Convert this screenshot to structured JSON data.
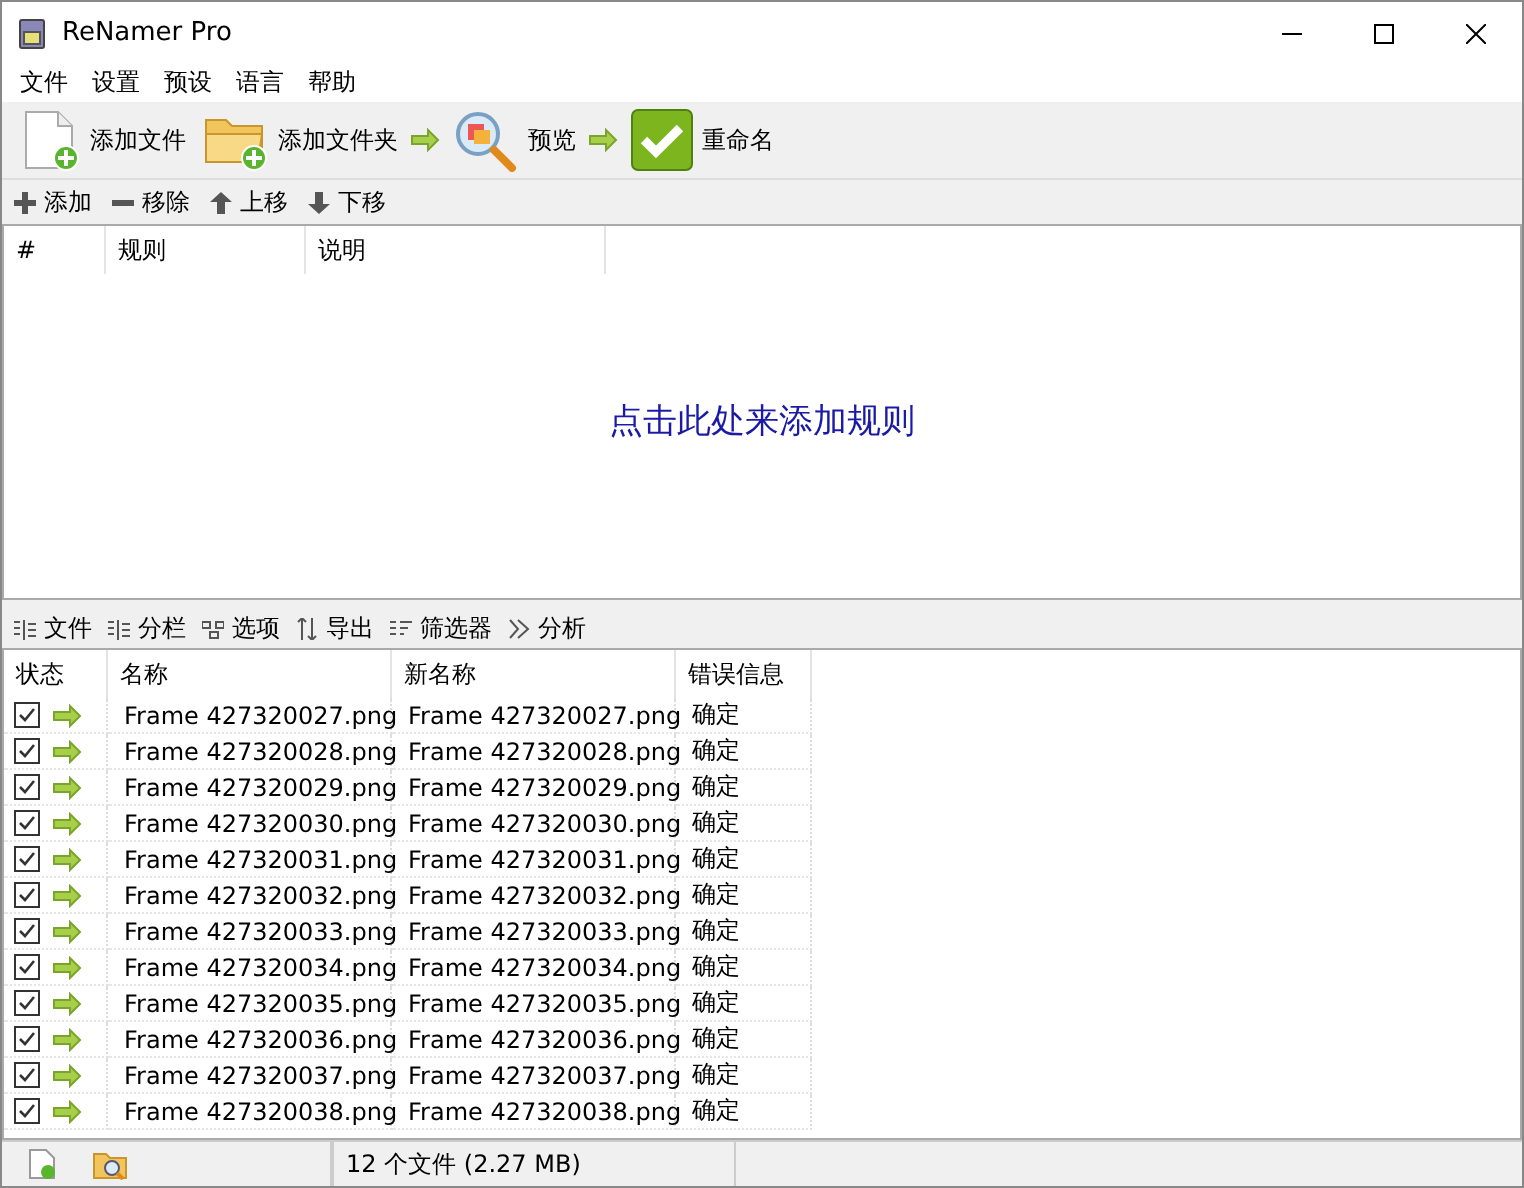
{
  "window": {
    "title": "ReNamer Pro"
  },
  "menu": [
    "文件",
    "设置",
    "预设",
    "语言",
    "帮助"
  ],
  "toolbar": [
    {
      "kind": "add-file",
      "label": "添加文件"
    },
    {
      "kind": "add-folder",
      "label": "添加文件夹"
    },
    {
      "kind": "preview",
      "label": "预览"
    },
    {
      "kind": "rename",
      "label": "重命名"
    }
  ],
  "rules_toolbar": [
    {
      "kind": "add",
      "label": "添加"
    },
    {
      "kind": "remove",
      "label": "移除"
    },
    {
      "kind": "up",
      "label": "上移"
    },
    {
      "kind": "down",
      "label": "下移"
    }
  ],
  "rules": {
    "columns": [
      "#",
      "规则",
      "说明"
    ],
    "hint": "点击此处来添加规则"
  },
  "files_toolbar": [
    {
      "kind": "list",
      "label": "文件"
    },
    {
      "kind": "list",
      "label": "分栏"
    },
    {
      "kind": "options",
      "label": "选项"
    },
    {
      "kind": "export",
      "label": "导出"
    },
    {
      "kind": "filter",
      "label": "筛选器"
    },
    {
      "kind": "analyze",
      "label": "分析"
    }
  ],
  "files": {
    "columns": [
      "状态",
      "名称",
      "新名称",
      "错误信息"
    ],
    "rows": [
      {
        "checked": true,
        "name": "Frame 427320027.png",
        "new_name": "Frame 427320027.png",
        "error": "确定"
      },
      {
        "checked": true,
        "name": "Frame 427320028.png",
        "new_name": "Frame 427320028.png",
        "error": "确定"
      },
      {
        "checked": true,
        "name": "Frame 427320029.png",
        "new_name": "Frame 427320029.png",
        "error": "确定"
      },
      {
        "checked": true,
        "name": "Frame 427320030.png",
        "new_name": "Frame 427320030.png",
        "error": "确定"
      },
      {
        "checked": true,
        "name": "Frame 427320031.png",
        "new_name": "Frame 427320031.png",
        "error": "确定"
      },
      {
        "checked": true,
        "name": "Frame 427320032.png",
        "new_name": "Frame 427320032.png",
        "error": "确定"
      },
      {
        "checked": true,
        "name": "Frame 427320033.png",
        "new_name": "Frame 427320033.png",
        "error": "确定"
      },
      {
        "checked": true,
        "name": "Frame 427320034.png",
        "new_name": "Frame 427320034.png",
        "error": "确定"
      },
      {
        "checked": true,
        "name": "Frame 427320035.png",
        "new_name": "Frame 427320035.png",
        "error": "确定"
      },
      {
        "checked": true,
        "name": "Frame 427320036.png",
        "new_name": "Frame 427320036.png",
        "error": "确定"
      },
      {
        "checked": true,
        "name": "Frame 427320037.png",
        "new_name": "Frame 427320037.png",
        "error": "确定"
      },
      {
        "checked": true,
        "name": "Frame 427320038.png",
        "new_name": "Frame 427320038.png",
        "error": "确定"
      }
    ]
  },
  "status_bar": {
    "summary": "12 个文件 (2.27 MB)"
  }
}
